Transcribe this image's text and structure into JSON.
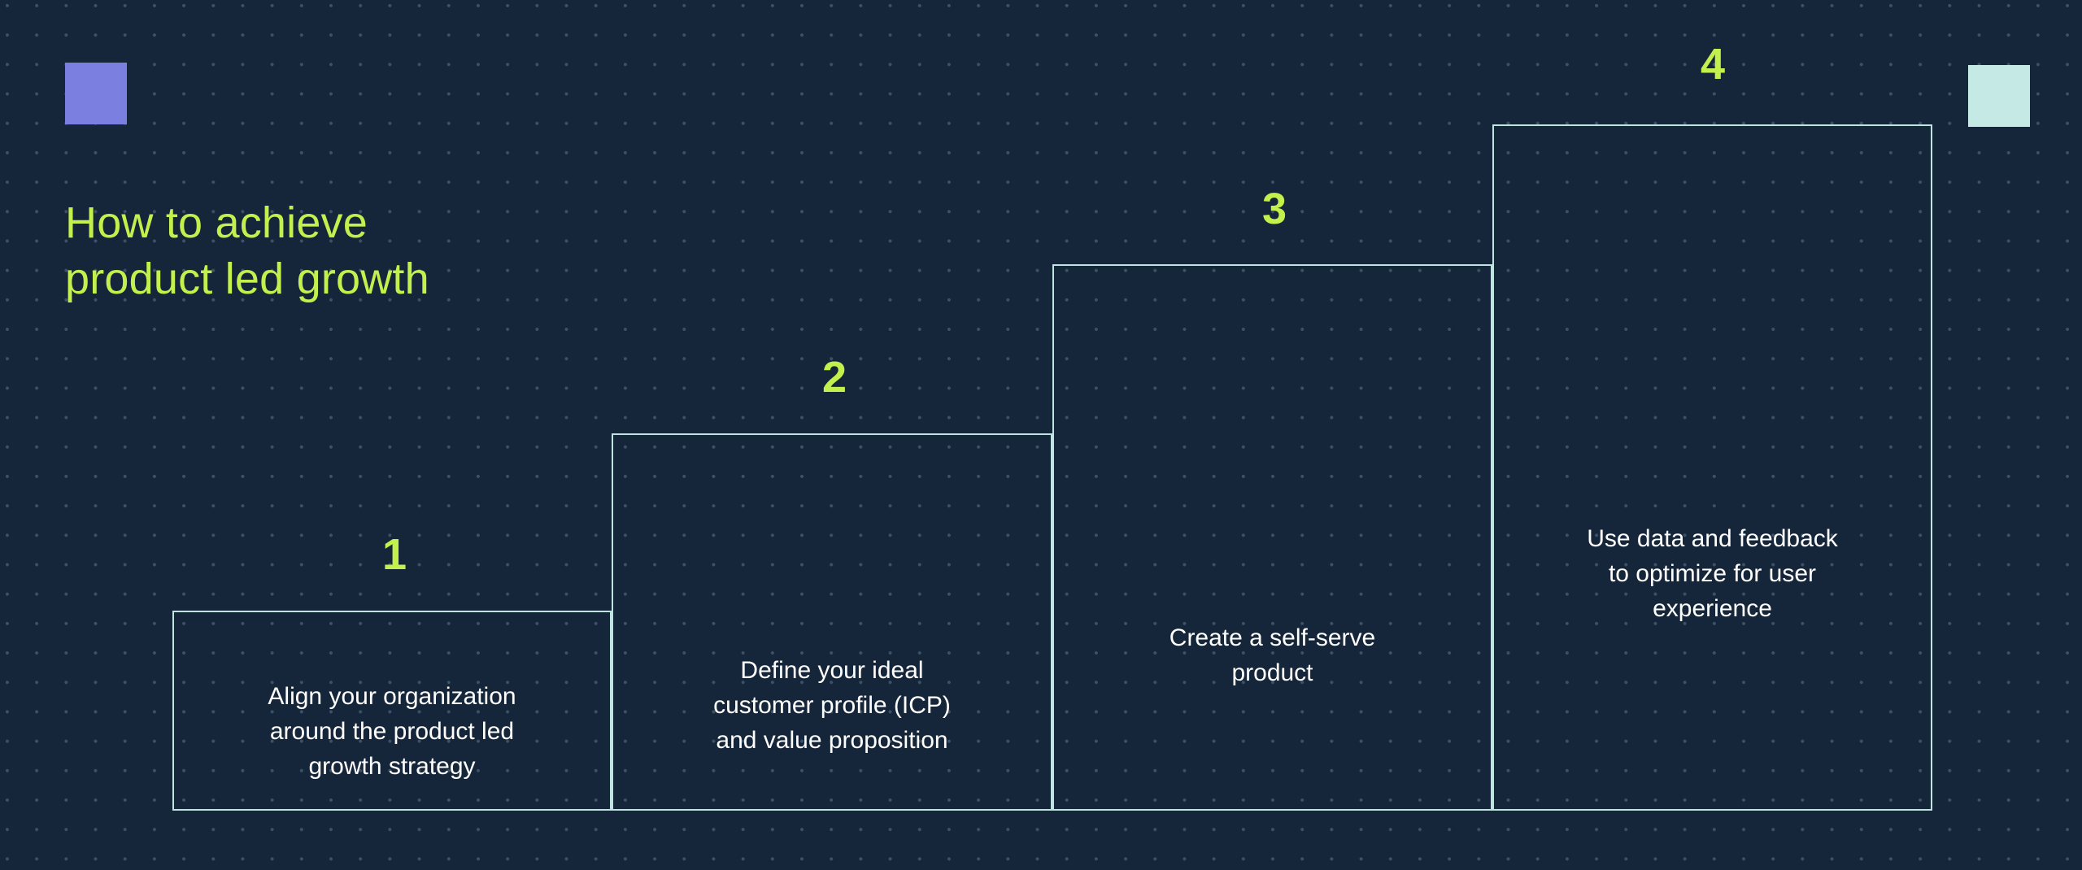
{
  "canvas": {
    "background_color": "#16263a",
    "dot_color": "#3c5166"
  },
  "decor": {
    "top_left_square_color": "#7b7fe0",
    "top_right_square_color": "#c5e9e5"
  },
  "headline": {
    "text": "How to achieve\nproduct led growth",
    "color": "#c3f04d"
  },
  "chart_data": {
    "type": "bar",
    "title": "How to achieve product led growth",
    "xlabel": "",
    "ylabel": "",
    "grid": false,
    "legend": "none",
    "orientation": "vertical-ascending-staircase",
    "categories": [
      "1",
      "2",
      "3",
      "4"
    ],
    "values": [
      246,
      464,
      672,
      844
    ],
    "value_units": "px (bar height, ascending step progression)",
    "bar_fill": "none",
    "bar_border_color": "#bfe3e0",
    "number_color": "#c3f04d",
    "label_color": "#ffffff",
    "annotations": [
      "Align your organization around the product led growth strategy",
      "Define your ideal customer profile (ICP) and value proposition",
      "Create a self-serve product",
      "Use data and feedback to optimize for user experience"
    ]
  },
  "steps": [
    {
      "number": "1",
      "text": "Align your organization\naround the product led\ngrowth strategy"
    },
    {
      "number": "2",
      "text": "Define your ideal\ncustomer profile (ICP)\nand value proposition"
    },
    {
      "number": "3",
      "text": "Create a self-serve\nproduct"
    },
    {
      "number": "4",
      "text": "Use data and feedback\nto optimize for user\nexperience"
    }
  ]
}
